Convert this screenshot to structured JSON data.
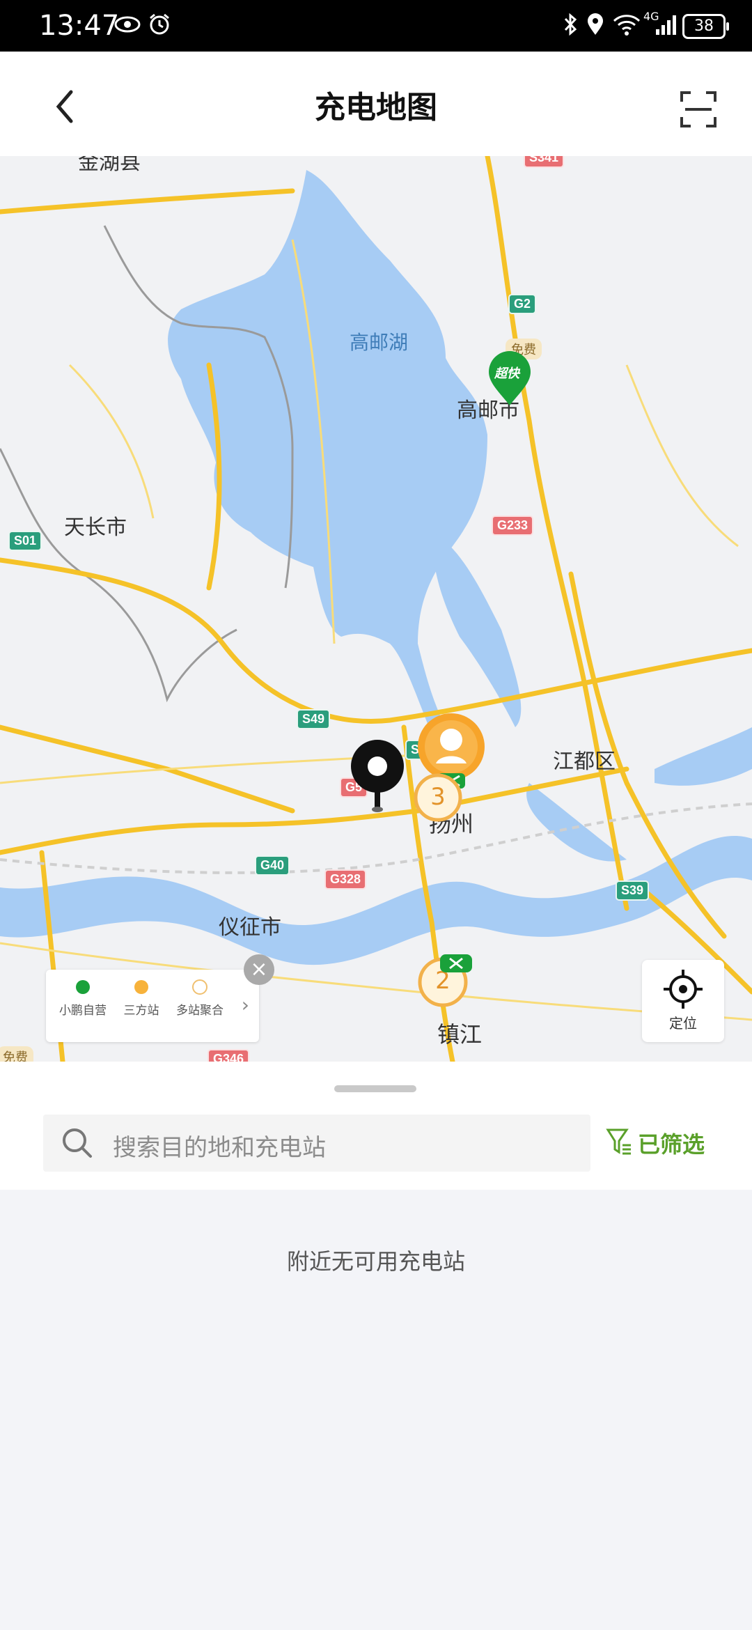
{
  "status_bar": {
    "time": "13:47",
    "battery": "38",
    "network": "4G",
    "icons": [
      "eye-icon",
      "alarm-icon",
      "bluetooth-icon",
      "location-icon",
      "wifi-icon",
      "signal-icon",
      "battery-icon"
    ]
  },
  "header": {
    "title": "充电地图",
    "back_icon": "chevron-left-icon",
    "scan_icon": "scan-icon"
  },
  "map": {
    "labels": {
      "jinhu": "金湖县",
      "gaoyou_lake": "高邮湖",
      "gaoyou_city": "高邮市",
      "tianchang": "天长市",
      "jiangdu": "江都区",
      "yangzhou": "扬州",
      "yizheng": "仪征市",
      "zhenjiang": "镇江"
    },
    "road_shields": {
      "g2": "G2",
      "g233": "G233",
      "s01": "S01",
      "s49": "S49",
      "g40": "G40",
      "g328": "G328",
      "s39": "S39",
      "g346": "G346",
      "g5": "G5",
      "s3": "S3",
      "s341": "S341"
    },
    "free_tag": "免费",
    "free_tag_left": "免费",
    "station_badge": "超快",
    "clusters": [
      {
        "count": "3"
      },
      {
        "count": "2"
      }
    ],
    "colors": {
      "water": "#a7ccf4",
      "highway": "#f5c228",
      "green_pin": "#1aa13a",
      "orange_pin": "#f7a42a"
    }
  },
  "legend": {
    "items": [
      {
        "label": "小鹏自营",
        "color": "#1aa13a"
      },
      {
        "label": "三方站",
        "color": "#f7b23b"
      },
      {
        "label": "多站聚合",
        "color": "#f0c070"
      }
    ],
    "close_icon": "close-icon",
    "more_icon": "chevron-right-icon"
  },
  "locate": {
    "label": "定位",
    "icon": "crosshair-icon"
  },
  "search": {
    "placeholder": "搜索目的地和充电站",
    "icon": "search-icon"
  },
  "filter": {
    "label": "已筛选",
    "icon": "filter-icon"
  },
  "empty_message": "附近无可用充电站"
}
